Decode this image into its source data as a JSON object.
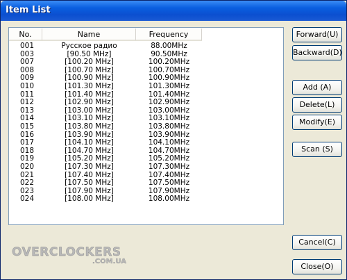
{
  "window": {
    "title": "Item List"
  },
  "list": {
    "columns": [
      "No.",
      "Name",
      "Frequency"
    ],
    "rows": [
      [
        "001",
        "Русское радио",
        "88.00MHz"
      ],
      [
        "003",
        "[90.50 MHz]",
        "90.50MHz"
      ],
      [
        "007",
        "[100.20 MHz]",
        "100.20MHz"
      ],
      [
        "008",
        "[100.70 MHz]",
        "100.70MHz"
      ],
      [
        "009",
        "[100.90 MHz]",
        "100.90MHz"
      ],
      [
        "010",
        "[101.30 MHz]",
        "101.30MHz"
      ],
      [
        "011",
        "[101.40 MHz]",
        "101.40MHz"
      ],
      [
        "012",
        "[102.90 MHz]",
        "102.90MHz"
      ],
      [
        "013",
        "[103.00 MHz]",
        "103.00MHz"
      ],
      [
        "014",
        "[103.10 MHz]",
        "103.10MHz"
      ],
      [
        "015",
        "[103.80 MHz]",
        "103.80MHz"
      ],
      [
        "016",
        "[103.90 MHz]",
        "103.90MHz"
      ],
      [
        "017",
        "[104.10 MHz]",
        "104.10MHz"
      ],
      [
        "018",
        "[104.70 MHz]",
        "104.70MHz"
      ],
      [
        "019",
        "[105.20 MHz]",
        "105.20MHz"
      ],
      [
        "020",
        "[107.30 MHz]",
        "107.30MHz"
      ],
      [
        "021",
        "[107.40 MHz]",
        "107.40MHz"
      ],
      [
        "022",
        "[107.50 MHz]",
        "107.50MHz"
      ],
      [
        "023",
        "[107.90 MHz]",
        "107.90MHz"
      ],
      [
        "024",
        "[108.00 MHz]",
        "108.00MHz"
      ]
    ]
  },
  "buttons": {
    "forward": "Forward(U)",
    "backward": "Backward(D)",
    "add": "Add (A)",
    "delete": "Delete(L)",
    "modify": "Modify(E)",
    "scan": "Scan (S)",
    "cancel": "Cancel(C)",
    "close": "Close(O)"
  },
  "watermark": {
    "text": "OVERCLOCKERS .COM.UA"
  },
  "colors": {
    "titlebar": "#0b4fd0",
    "face": "#ece9d8",
    "list_bg": "#ffffff",
    "button_border": "#003c74"
  }
}
